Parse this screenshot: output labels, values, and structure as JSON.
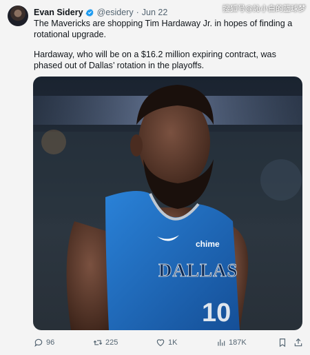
{
  "author": {
    "name": "Evan Sidery",
    "handle": "@esidery",
    "separator": "·",
    "date": "Jun 22",
    "verified": true,
    "verified_color": "#1d9bf0"
  },
  "watermark": "搜狐号@訫小白的篮球梦",
  "body": {
    "paragraph1": "The Mavericks are shopping Tim Hardaway Jr. in hopes of finding a rotational upgrade.",
    "paragraph2": "Hardaway, who will be on a $16.2 million expiring contract, was phased out of Dallas’ rotation in the playoffs."
  },
  "media": {
    "jersey_text": "DALLAS",
    "sponsor": "chime",
    "number": "10",
    "jersey_color": "#1f6fc4"
  },
  "actions": {
    "replies": "96",
    "retweets": "225",
    "likes": "1K",
    "views": "187K"
  },
  "icons": {
    "reply": "reply-icon",
    "retweet": "retweet-icon",
    "like": "heart-icon",
    "views": "views-icon",
    "bookmark": "bookmark-icon",
    "share": "share-icon"
  }
}
